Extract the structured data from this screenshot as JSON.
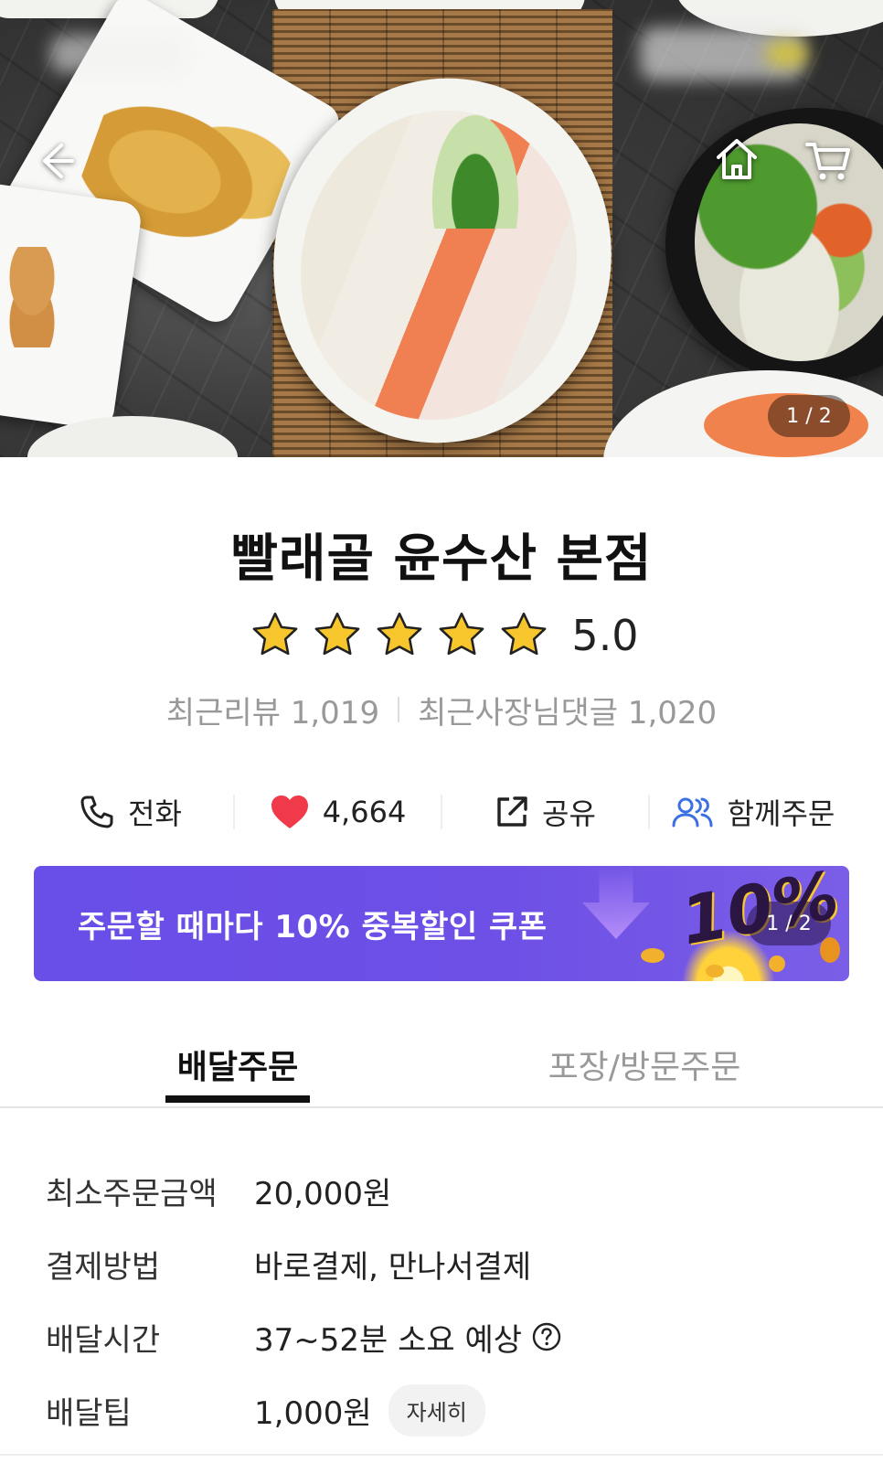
{
  "hero": {
    "image_counter": "1 / 2"
  },
  "store": {
    "name": "빨래골 윤수산 본점",
    "rating_value": "5.0",
    "stars": 5,
    "recent_reviews": "최근리뷰 1,019",
    "recent_owner_replies": "최근사장님댓글 1,020"
  },
  "actions": {
    "call": "전화",
    "likes": "4,664",
    "share": "공유",
    "group_order": "함께주문"
  },
  "banner": {
    "text": "주문할 때마다 10% 중복할인 쿠폰",
    "graphic_text": "10%",
    "counter": "1 / 2"
  },
  "tabs": {
    "delivery": "배달주문",
    "pickup": "포장/방문주문"
  },
  "info": {
    "min_order_label": "최소주문금액",
    "min_order_value": "20,000원",
    "payment_label": "결제방법",
    "payment_value": "바로결제, 만나서결제",
    "delivery_time_label": "배달시간",
    "delivery_time_value": "37~52분 소요 예상",
    "delivery_tip_label": "배달팁",
    "delivery_tip_value": "1,000원",
    "detail_button": "자세히"
  },
  "colors": {
    "banner_purple": "#6a4ee8",
    "heart_red": "#f03a4a",
    "group_blue": "#3a6fe6",
    "star_gold": "#f7c52c"
  }
}
